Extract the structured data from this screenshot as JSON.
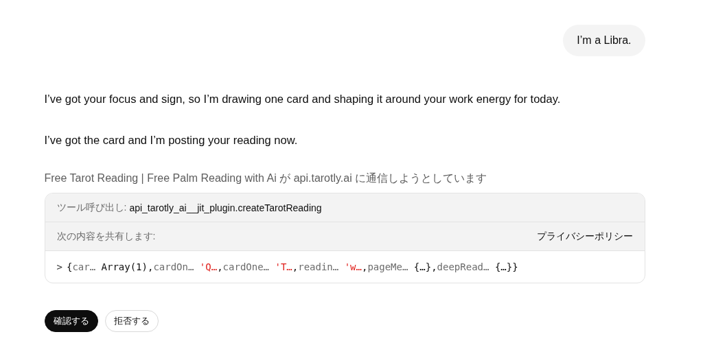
{
  "user_message": "I’m a Libra.",
  "assistant_messages": [
    "I’ve got your focus and sign, so I’m drawing one card and shaping it around your work energy for today.",
    "I’ve got the card and I’m posting your reading now."
  ],
  "permission": {
    "notice": "Free Tarot Reading | Free Palm Reading with Ai が api.tarotly.ai に通信しようとしています",
    "tool_call_label": "ツール呼び出し:",
    "tool_call_name": "api_tarotly_ai__jit_plugin.createTarotReading",
    "share_label": "次の内容を共有します:",
    "privacy_link": "プライバシーポリシー",
    "preview": {
      "expander": ">",
      "open": "{",
      "close": "}",
      "entries": [
        {
          "key": "car…",
          "value": "Array(1)",
          "kind": "object",
          "separator": ","
        },
        {
          "key": "cardOn…",
          "value": "'Q…",
          "kind": "string",
          "separator": ","
        },
        {
          "key": "cardOne…",
          "value": "'T…",
          "kind": "string",
          "separator": ","
        },
        {
          "key": "readin…",
          "value": "'w…",
          "kind": "string",
          "separator": ","
        },
        {
          "key": "pageMe…",
          "value": "{…}",
          "kind": "object",
          "separator": ","
        },
        {
          "key": "deepRead…",
          "value": "{…}",
          "kind": "object"
        }
      ]
    }
  },
  "buttons": [
    {
      "label": "確認する",
      "kind": "primary"
    },
    {
      "label": "拒否する",
      "kind": "secondary"
    }
  ]
}
